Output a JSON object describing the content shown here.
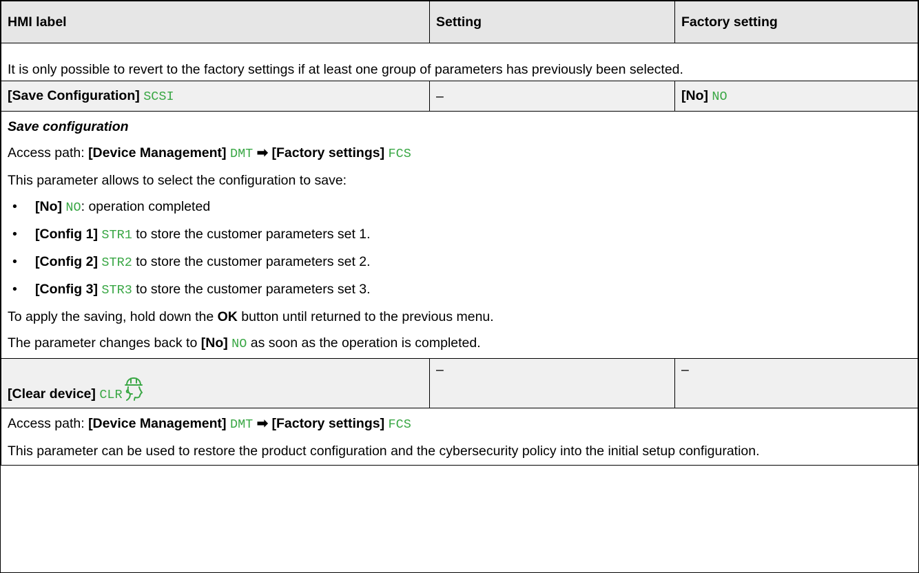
{
  "table": {
    "headers": [
      "HMI label",
      "Setting",
      "Factory setting"
    ],
    "intro_note": "It is only possible to revert to the factory settings if at least one group of parameters has previously been selected.",
    "row_save": {
      "label": "[Save Configuration]",
      "code": "SCSI",
      "setting": "–",
      "factory_label": "[No]",
      "factory_code": "NO"
    },
    "save_desc": {
      "title": "Save configuration",
      "access_prefix": "Access path: ",
      "path1_label": "[Device Management]",
      "path1_code": "DMT",
      "arrow": "➡",
      "path2_label": "[Factory settings]",
      "path2_code": "FCS",
      "intro": "This parameter allows to select the configuration to save:",
      "options": [
        {
          "label": "[No]",
          "code": "NO",
          "text": ": operation completed"
        },
        {
          "label": "[Config 1]",
          "code": "STR1",
          "text": " to store the customer parameters set 1."
        },
        {
          "label": "[Config 2]",
          "code": "STR2",
          "text": " to store the customer parameters set 2."
        },
        {
          "label": "[Config 3]",
          "code": "STR3",
          "text": " to store the customer parameters set 3."
        }
      ],
      "apply_pre": "To apply the saving, hold down the ",
      "apply_ok": "OK",
      "apply_post": " button until returned to the previous menu.",
      "back_pre": "The parameter changes back to ",
      "back_label": "[No]",
      "back_code": "NO",
      "back_post": " as soon as the operation is completed."
    },
    "row_clear": {
      "label": "[Clear device]",
      "code": "CLR",
      "icon": "helmet-icon",
      "setting": "–",
      "factory": "–"
    },
    "clear_desc": {
      "access_prefix": "Access path: ",
      "path1_label": "[Device Management]",
      "path1_code": "DMT",
      "arrow": "➡",
      "path2_label": "[Factory settings]",
      "path2_code": "FCS",
      "text": "This parameter can be used to restore the product configuration and the cybersecurity policy into the initial setup configuration."
    }
  },
  "colors": {
    "code": "#3aa745",
    "header_bg": "#e6e6e6",
    "param_bg": "#f0f0f0"
  }
}
